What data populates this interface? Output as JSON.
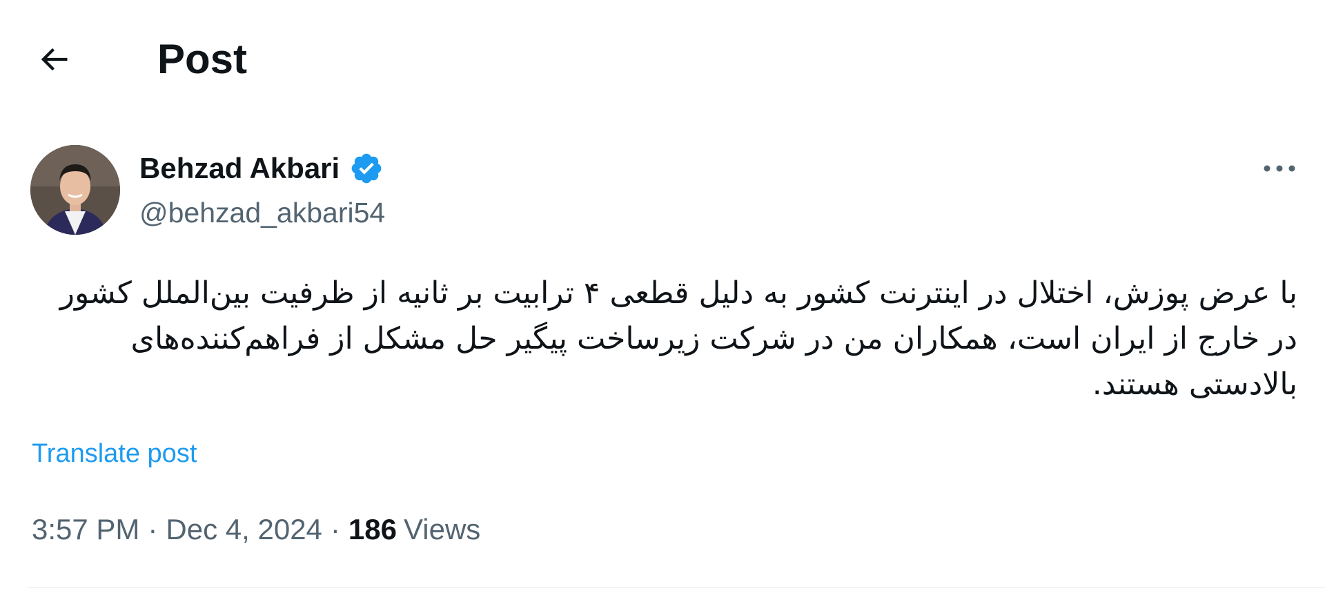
{
  "header": {
    "back_icon": "arrow-left-icon",
    "title": "Post"
  },
  "author": {
    "name": "Behzad Akbari",
    "verified_icon": "verified-badge-icon",
    "verified_color": "#1d9bf0",
    "handle": "@behzad_akbari54",
    "avatar_icon": "profile-photo"
  },
  "more_icon": "more-horizontal-icon",
  "post": {
    "text": "با عرض پوزش، اختلال در اینترنت کشور به دلیل قطعی ۴ ترابیت بر ثانیه از ظرفیت بین‌الملل کشور در خارج از ایران است، همکاران من در شرکت زیرساخت پیگیر حل مشکل از فراهم‌کننده‌های بالادستی هستند.",
    "translate_label": "Translate post"
  },
  "meta": {
    "time": "3:57 PM",
    "separator": "·",
    "date": "Dec 4, 2024",
    "views_count": "186",
    "views_label": "Views"
  },
  "colors": {
    "accent": "#1d9bf0",
    "text_primary": "#0f1419",
    "text_secondary": "#536471"
  }
}
